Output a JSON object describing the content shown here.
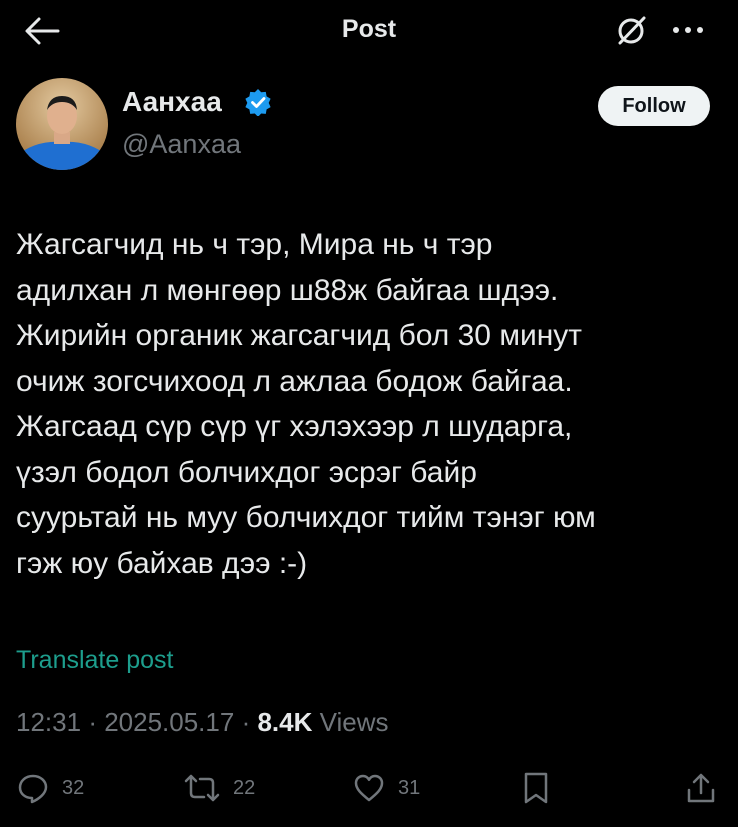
{
  "header": {
    "title": "Post",
    "icons": {
      "back": "arrow-left-icon",
      "grok": "grok-icon",
      "more": "more-icon"
    }
  },
  "author": {
    "display_name": "Аанхаа",
    "handle": "@Aanxaa",
    "verified": true,
    "follow_label": "Follow"
  },
  "post": {
    "text": "Жагсагчид нь ч тэр, Мира нь ч тэр\nадилхан л мөнгөөр ш88ж байгаа шдээ.\nЖирийн органик жагсагчид бол 30 минут\nочиж зогсчихоод л ажлаа бодож байгаа.\nЖагсаад сүр сүр үг хэлэхээр л шударга,\nүзэл бодол болчихдог эсрэг байр\nсуурьтай нь муу болчихдог тийм тэнэг юм\nгэж юу байхав дээ :-)",
    "translate_label": "Translate post",
    "time": "12:31",
    "date": "2025.05.17",
    "views_count": "8.4K",
    "views_label": "Views"
  },
  "actions": {
    "replies": "32",
    "reposts": "22",
    "likes": "31"
  },
  "colors": {
    "background": "#000000",
    "text": "#e7e9ea",
    "secondary": "#71767b",
    "verified": "#1d9bf0",
    "translate": "#1d9e8d"
  }
}
